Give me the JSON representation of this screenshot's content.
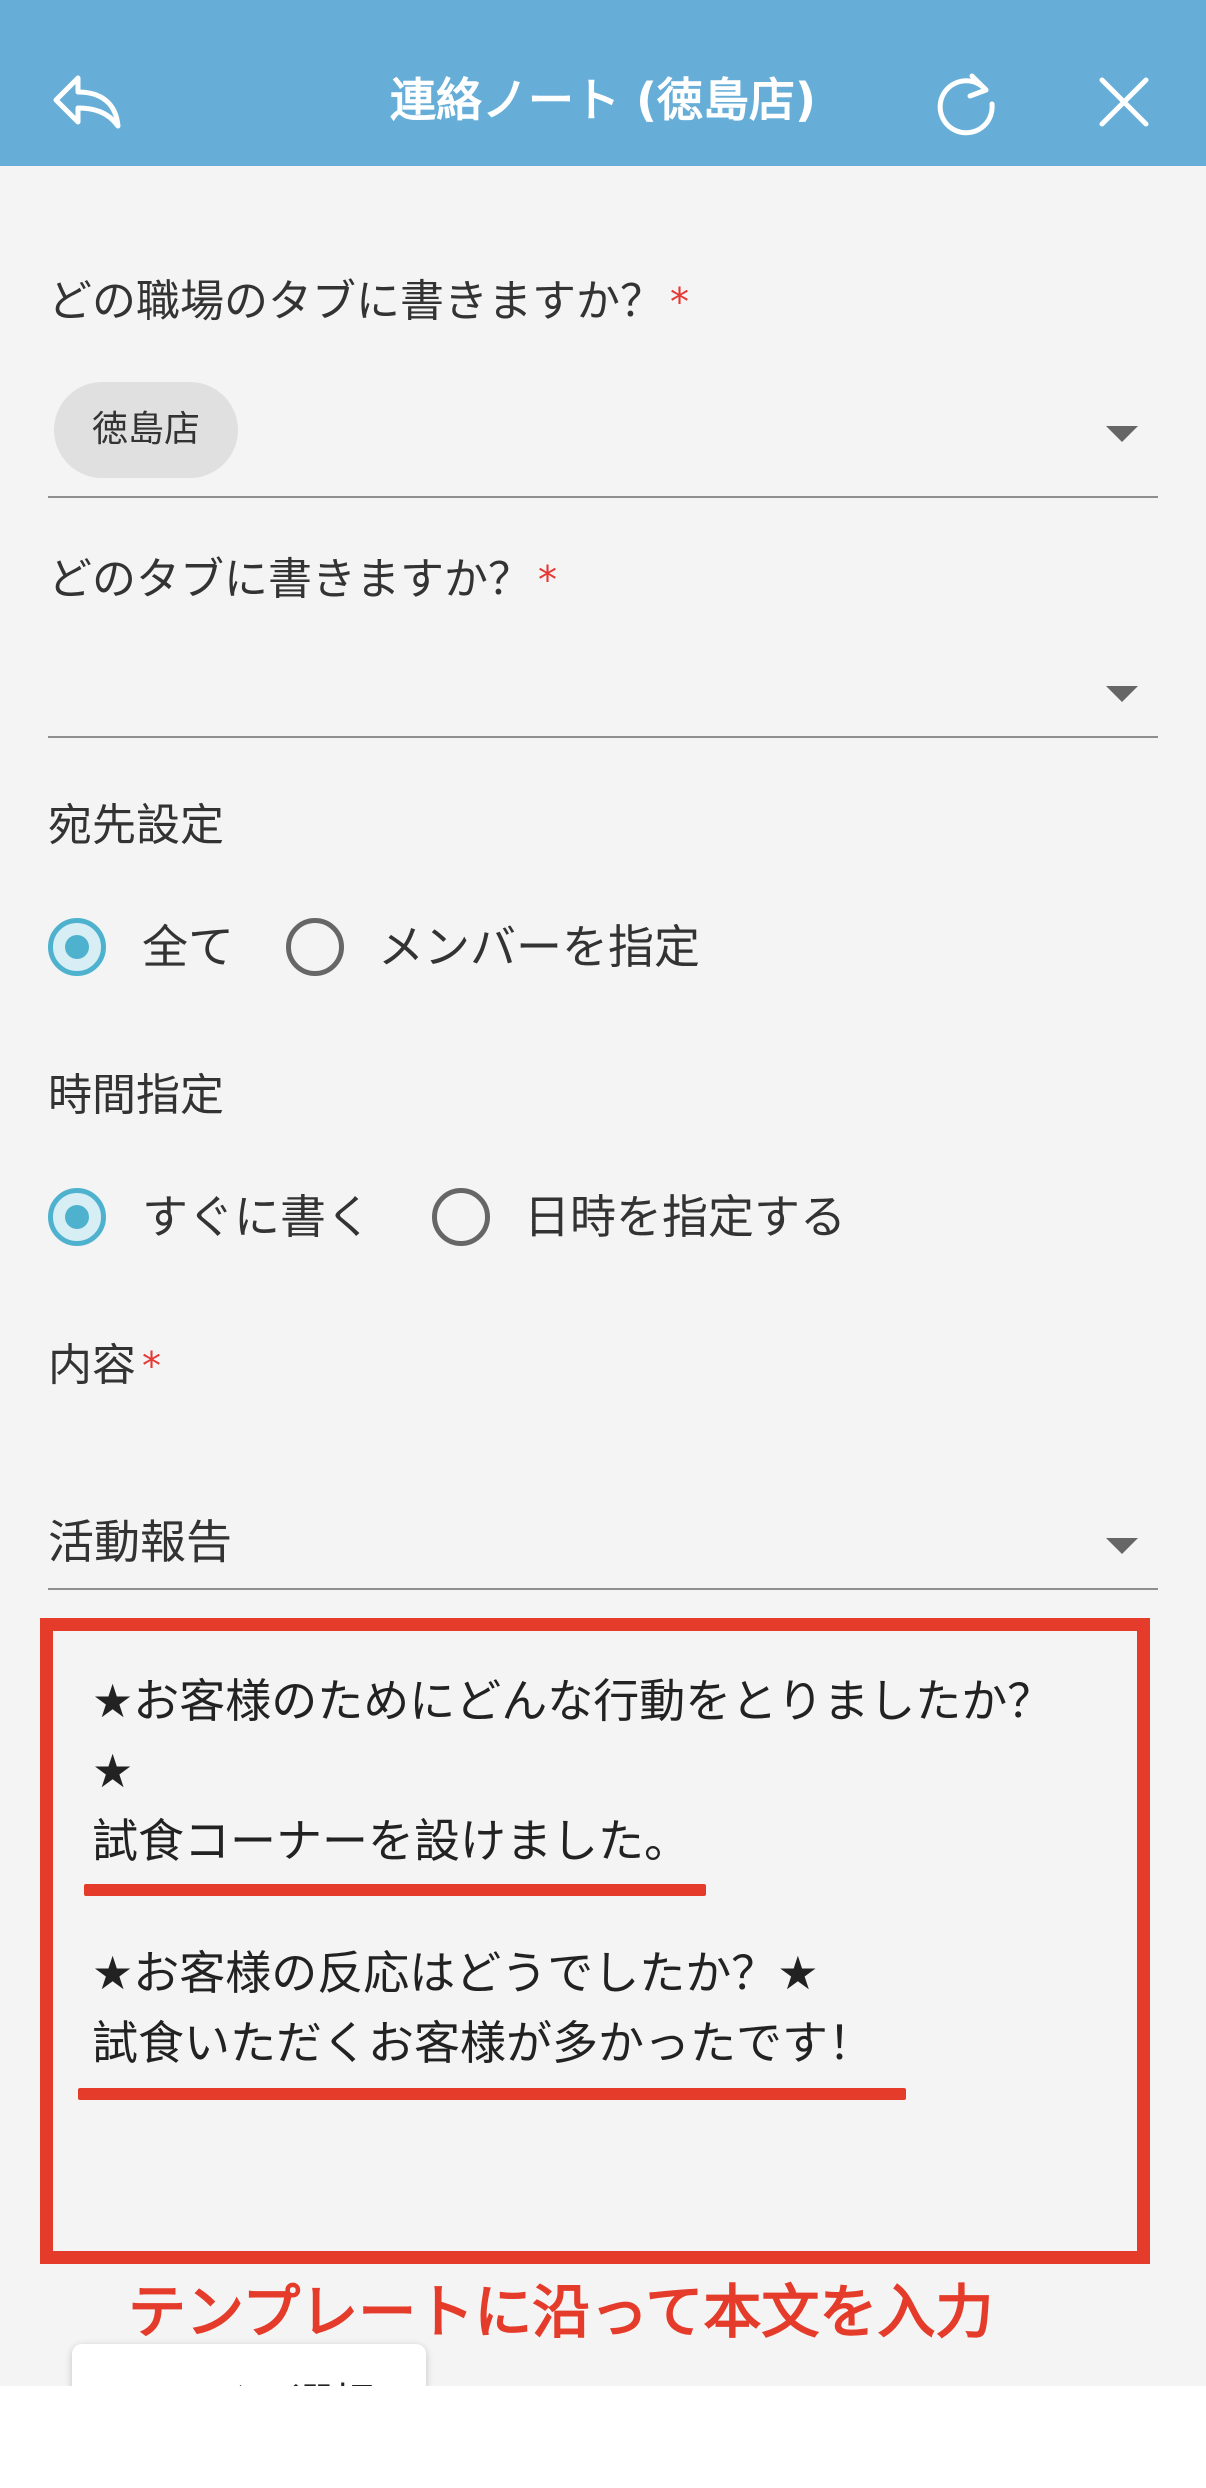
{
  "header": {
    "title": "連絡ノート (徳島店)",
    "back_icon": "reply-arrow-icon",
    "refresh_icon": "refresh-icon",
    "close_icon": "close-icon",
    "background_color": "#66aed7"
  },
  "form": {
    "workplace": {
      "label": "どの職場のタブに書きますか？",
      "required_mark": "*",
      "selected_chip": "徳島店"
    },
    "tab": {
      "label": "どのタブに書きますか？",
      "required_mark": "*",
      "value": ""
    },
    "recipient": {
      "label": "宛先設定",
      "options": [
        "全て",
        "メンバーを指定"
      ],
      "selected": "全て"
    },
    "timing": {
      "label": "時間指定",
      "options": [
        "すぐに書く",
        "日時を指定する"
      ],
      "selected": "すぐに書く"
    },
    "content": {
      "label": "内容",
      "required_mark": "*",
      "template_value": "活動報告",
      "body_lines": [
        "★お客様のためにどんな行動をとりましたか？",
        "★",
        "試食コーナーを設けました。",
        "★お客様の反応はどうでしたか？★",
        "試食いただくお客様が多かったです！"
      ]
    },
    "file_button_label": "ファイル選択"
  },
  "annotation": {
    "caption": "テンプレートに沿って本文を入力",
    "color": "#e53b2a"
  }
}
